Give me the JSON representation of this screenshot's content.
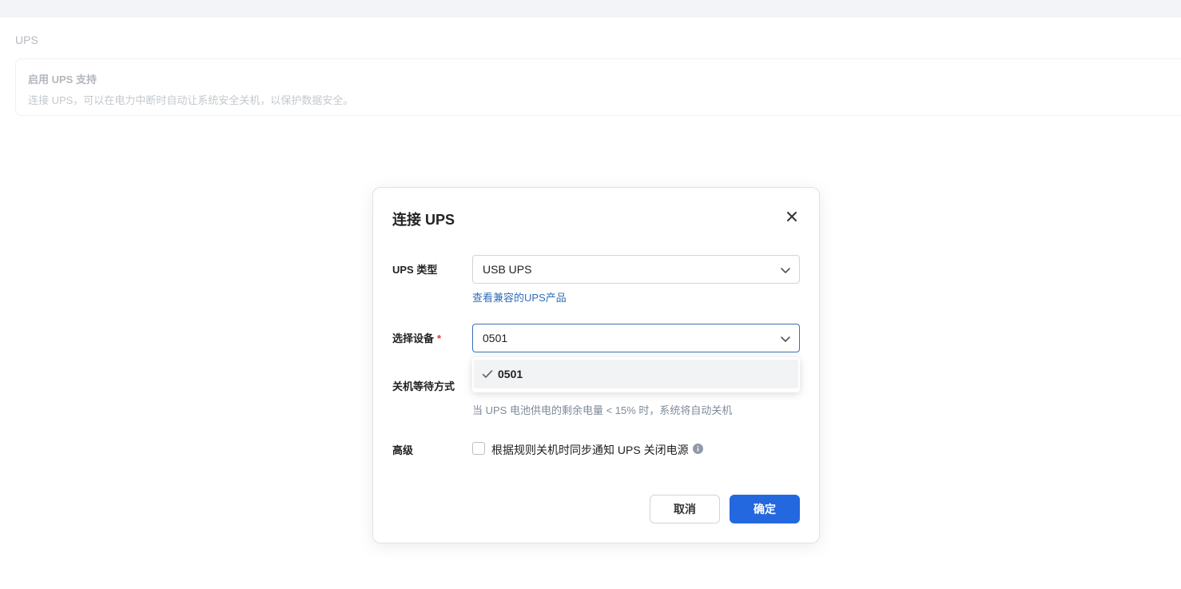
{
  "page": {
    "section_title": "UPS",
    "card": {
      "title": "启用 UPS 支持",
      "description": "连接 UPS，可以在电力中断时自动让系统安全关机，以保护数据安全。"
    }
  },
  "modal": {
    "title": "连接 UPS",
    "close_icon": "close-icon",
    "ups_type": {
      "label": "UPS 类型",
      "value": "USB UPS"
    },
    "compat_link": {
      "prefix": "查看",
      "link_text": "兼容的UPS产品"
    },
    "device": {
      "label": "选择设备",
      "required_mark": "*",
      "value": "0501",
      "options": [
        {
          "label": "0501",
          "selected": true
        }
      ]
    },
    "shutdown": {
      "label": "关机等待方式",
      "hint": "当 UPS 电池供电的剩余电量 < 15% 时，系统将自动关机"
    },
    "advanced": {
      "label": "高级",
      "checkbox_label": "根据规则关机时同步通知 UPS 关闭电源",
      "checked": false
    },
    "buttons": {
      "cancel": "取消",
      "confirm": "确定"
    }
  },
  "colors": {
    "primary": "#2468e0",
    "link": "#2f6fb7",
    "required": "#e5383b",
    "hint": "#7f8a9a"
  }
}
